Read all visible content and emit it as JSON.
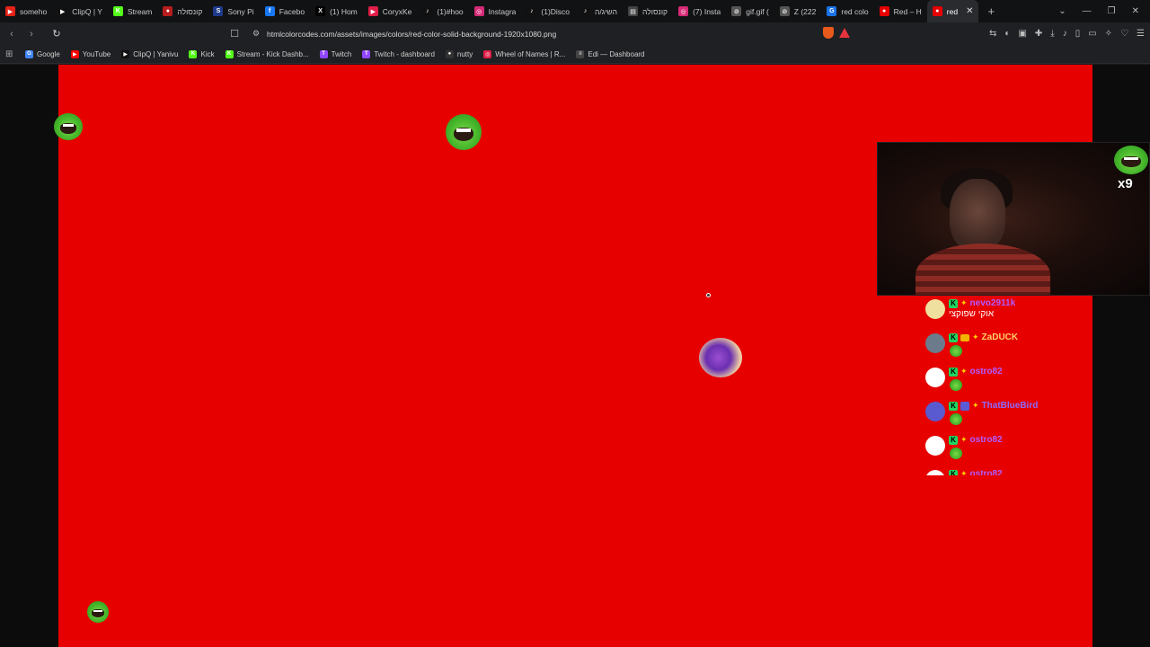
{
  "tabs": [
    {
      "label": "someho",
      "color": "#e62117",
      "glyph": "▶"
    },
    {
      "label": "ClipQ | Y",
      "color": "#111111",
      "glyph": "▶"
    },
    {
      "label": "Stream",
      "color": "#53fc18",
      "glyph": "K"
    },
    {
      "label": "קונסולה",
      "color": "#b91c1c",
      "glyph": "●"
    },
    {
      "label": "Sony Pi",
      "color": "#1e3a8a",
      "glyph": "S"
    },
    {
      "label": "Facebo",
      "color": "#1877f2",
      "glyph": "f"
    },
    {
      "label": "(1) Hom",
      "color": "#000000",
      "glyph": "X"
    },
    {
      "label": "CoryxKe",
      "color": "#e11d48",
      "glyph": "▶"
    },
    {
      "label": "(1)#hoo",
      "color": "#111111",
      "glyph": "♪"
    },
    {
      "label": "Instagra",
      "color": "#d62976",
      "glyph": "◎"
    },
    {
      "label": "(1)Disco",
      "color": "#111111",
      "glyph": "♪"
    },
    {
      "label": "השיג/ה",
      "color": "#111111",
      "glyph": "♪"
    },
    {
      "label": "קונסולה",
      "color": "#444444",
      "glyph": "▤"
    },
    {
      "label": "(7) Insta",
      "color": "#d62976",
      "glyph": "◎"
    },
    {
      "label": "gif.gif (",
      "color": "#555555",
      "glyph": "⊘"
    },
    {
      "label": "Z (222",
      "color": "#555555",
      "glyph": "⊘"
    },
    {
      "label": "red colo",
      "color": "#1a73e8",
      "glyph": "G"
    },
    {
      "label": "Red – H",
      "color": "#e60000",
      "glyph": "●"
    },
    {
      "label": "red",
      "color": "#e60000",
      "glyph": "●",
      "active": true
    }
  ],
  "tab_close": "✕",
  "tab_new": "+",
  "window_controls": {
    "dropdown": "⌄",
    "minimize": "—",
    "restore": "❐",
    "close": "✕"
  },
  "toolbar": {
    "back": "‹",
    "forward": "›",
    "reload": "↻",
    "bookmark_icon": "☐",
    "site_info_icon": "⚙",
    "url": "htmlcolorcodes.com/assets/images/colors/red-color-solid-background-1920x1080.png",
    "icons": [
      "⇆",
      "◐",
      "▣",
      "✚",
      "⤓",
      "♪",
      "▯",
      "▭",
      "✧",
      "♡",
      "☰"
    ]
  },
  "bookmarks": [
    {
      "label": "Google",
      "color": "#4285f4",
      "glyph": "G"
    },
    {
      "label": "YouTube",
      "color": "#ff0000",
      "glyph": "▶"
    },
    {
      "label": "ClipQ | Yanivu",
      "color": "#111111",
      "glyph": "▶"
    },
    {
      "label": "Kick",
      "color": "#53fc18",
      "glyph": "K"
    },
    {
      "label": "Stream - Kick Dashb...",
      "color": "#53fc18",
      "glyph": "K"
    },
    {
      "label": "Twitch",
      "color": "#9146ff",
      "glyph": "T"
    },
    {
      "label": "Twitch - dashboard",
      "color": "#9146ff",
      "glyph": "T"
    },
    {
      "label": "nutty",
      "color": "#333333",
      "glyph": "●"
    },
    {
      "label": "Wheel of Names | R...",
      "color": "#e11d48",
      "glyph": "◎"
    },
    {
      "label": "Edi — Dashboard",
      "color": "#444444",
      "glyph": "≡"
    }
  ],
  "webcam_overlay": {
    "counter": "x9"
  },
  "chat": [
    {
      "user": "nevo2911k",
      "user_color": "#b15bff",
      "text": "אוקי שפוקצי",
      "avatar_color": "#f0e0a0"
    },
    {
      "user": "ZaDUCK",
      "user_color": "#ffd166",
      "text": "",
      "avatar_color": "#6b7b8c"
    },
    {
      "user": "ostro82",
      "user_color": "#b15bff",
      "text": "",
      "avatar_color": "#ffffff"
    },
    {
      "user": "ThatBlueBird",
      "user_color": "#8b6bff",
      "text": "",
      "avatar_color": "#5a5ad0"
    },
    {
      "user": "ostro82",
      "user_color": "#b15bff",
      "text": "",
      "avatar_color": "#ffffff"
    },
    {
      "user": "ostro82",
      "user_color": "#b15bff",
      "text": "",
      "avatar_color": "#ffffff"
    }
  ],
  "colors": {
    "page_background": "#e60000",
    "accent": "#53fc18"
  }
}
